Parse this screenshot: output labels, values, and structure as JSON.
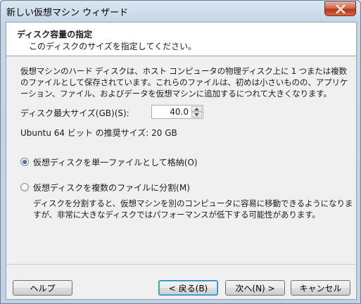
{
  "window": {
    "title": "新しい仮想マシン ウィザード"
  },
  "header": {
    "title": "ディスク容量の指定",
    "subtitle": "このディスクのサイズを指定してください。"
  },
  "description": "仮想マシンのハード ディスクは、ホスト コンピュータの物理ディスク上に 1 つまたは複数のファイルとして保存されています。これらのファイルは、初めは小さいものの、アプリケーション、ファイル、およびデータを仮想マシンに追加するにつれて大きくなります。",
  "disk_size": {
    "label": "ディスク最大サイズ(GB)(S):",
    "value": "40.0"
  },
  "recommended": "Ubuntu 64 ビット の推奨サイズ: 20 GB",
  "options": {
    "single_file": {
      "label": "仮想ディスクを単一ファイルとして格納(O)",
      "checked": true
    },
    "split_files": {
      "label": "仮想ディスクを複数のファイルに分割(M)",
      "checked": false
    },
    "split_description": "ディスクを分割すると、仮想マシンを別のコンピュータに容易に移動できるようになりますが、非常に大きなディスクではパフォーマンスが低下する可能性があります。"
  },
  "buttons": {
    "help": "ヘルプ",
    "back": "< 戻る(B)",
    "next": "次へ(N) >",
    "cancel": "キャンセル"
  },
  "icons": {
    "close": "close-icon",
    "spin_up": "spin-up-icon",
    "spin_down": "spin-down-icon"
  },
  "colors": {
    "close_button": "#c7462a",
    "default_button_border": "#3c7fb1",
    "header_background": "#ffffff",
    "dialog_background": "#f0f0f0"
  }
}
